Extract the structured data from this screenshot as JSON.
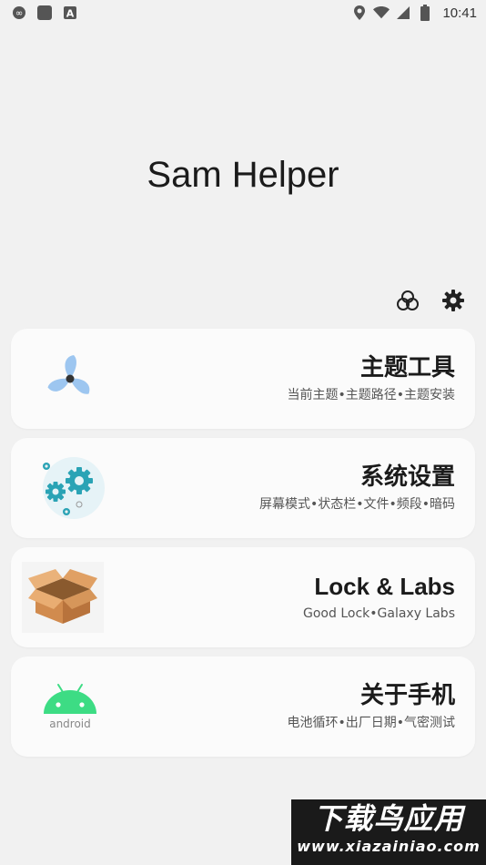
{
  "status_bar": {
    "time": "10:41",
    "left_icons": [
      "infinity-icon",
      "square-app-icon",
      "a-badge-icon"
    ],
    "right_icons": [
      "location-icon",
      "wifi-icon",
      "signal-icon",
      "battery-icon"
    ]
  },
  "app": {
    "title": "Sam Helper"
  },
  "top_actions": {
    "icons": [
      "radiation-icon",
      "gear-icon"
    ]
  },
  "cards": [
    {
      "title": "主题工具",
      "subtitle": "当前主题•主题路径•主题安装",
      "icon": "fan-icon"
    },
    {
      "title": "系统设置",
      "subtitle": "屏幕模式•状态栏•文件•频段•暗码",
      "icon": "gears-icon"
    },
    {
      "title": "Lock & Labs",
      "subtitle": "Good Lock•Galaxy Labs",
      "icon": "box-icon"
    },
    {
      "title": "关于手机",
      "subtitle": "电池循环•出厂日期•气密测试",
      "icon": "android-icon"
    }
  ],
  "watermark": {
    "line1": "下载鸟应用",
    "line2": "www.xiazainiao.com"
  },
  "colors": {
    "background": "#f1f1f1",
    "card": "#fbfbfb",
    "gear_teal": "#2aa3b5",
    "android_green": "#3ddc84",
    "box_orange": "#e0a064",
    "fan_blue": "#9dc6f0"
  }
}
